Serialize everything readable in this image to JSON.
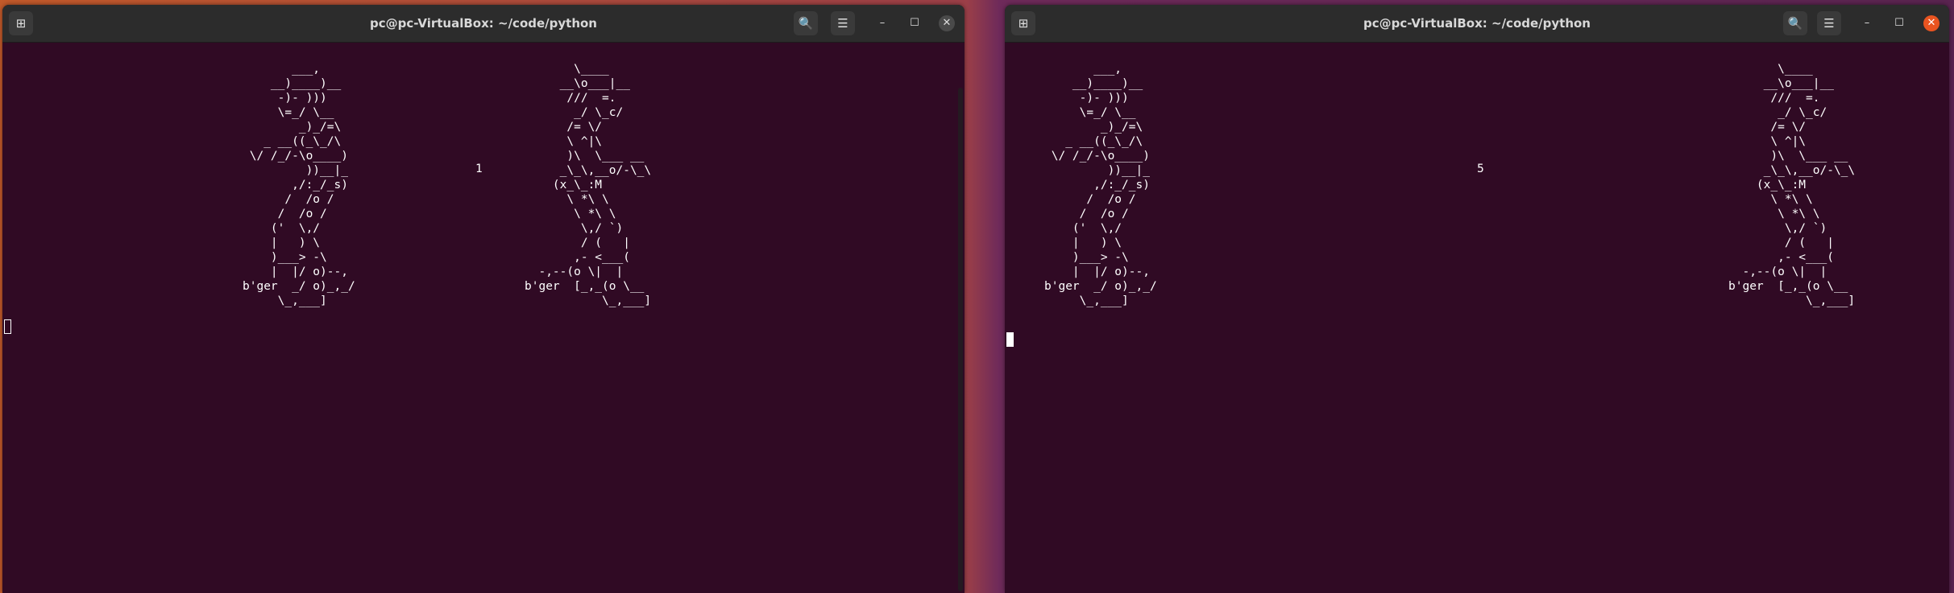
{
  "left_window": {
    "title": "pc@pc-VirtualBox: ~/code/python",
    "new_tab_icon": "new-tab-icon",
    "counter": "1",
    "art_a": "       ___,\n    __)____)__\n     -)- )))\n     \\=_/ \\__\n        _)_/=\\\n   _ __((_\\_/\\\n \\/ /_/-\\o____)\n         ))__|_\n       ,/:_/_s)\n      /  /o /\n     /  /o /\n    ('  \\,/\n    |   ) \\\n    )___> -\\\n    |  |/ o)--,\nb'ger  _/ o)_,_/\n     \\_,___]",
    "art_b": "       \\____\n     __\\o___|__\n      ///  =.\n       _/ \\_c/\n      /= \\/\n      \\ ^|\\\n      )\\  \\___ __\n     _\\_\\,__o/-\\_\\\n    (x_\\_:M\n      \\ *\\ \\\n       \\ *\\ \\\n        \\,/ `)\n        / (   |\n       ,- <___(\n  -,--(o \\|  |\nb'ger  [_,_(o \\__\n           \\_,___]"
  },
  "right_window": {
    "title": "pc@pc-VirtualBox: ~/code/python",
    "new_tab_icon": "new-tab-icon",
    "counter": "5",
    "art_a": "       ___,\n    __)____)__\n     -)- )))\n     \\=_/ \\__\n        _)_/=\\\n   _ __((_\\_/\\\n \\/ /_/-\\o____)\n         ))__|_\n       ,/:_/_s)\n      /  /o /\n     /  /o /\n    ('  \\,/\n    |   ) \\\n    )___> -\\\n    |  |/ o)--,\nb'ger  _/ o)_,_/\n     \\_,___]",
    "art_b": "       \\____\n     __\\o___|__\n      ///  =.\n       _/ \\_c/\n      /= \\/\n      \\ ^|\\\n      )\\  \\___ __\n     _\\_\\,__o/-\\_\\\n    (x_\\_:M\n      \\ *\\ \\\n       \\ *\\ \\\n        \\,/ `)\n        / (   |\n       ,- <___(\n  -,--(o \\|  |\nb'ger  [_,_(o \\__\n           \\_,___]"
  },
  "controls": {
    "search": "🔍",
    "menu": "☰",
    "minimize": "–",
    "maximize": "☐",
    "close": "✕",
    "new_tab": "⊞"
  },
  "colors": {
    "terminal_bg": "#300a24",
    "titlebar": "#2c2c2c",
    "close_active": "#e95420"
  }
}
